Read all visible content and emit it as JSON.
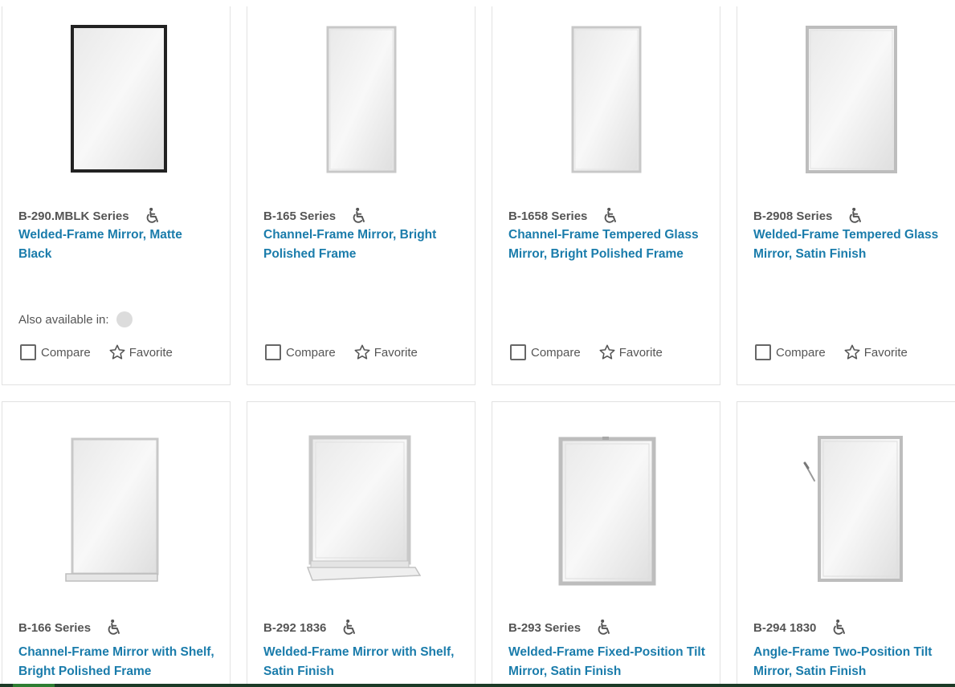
{
  "products": [
    {
      "series": "B-290.MBLK Series",
      "title": "Welded-Frame Mirror, Matte Black",
      "frame_color": "#222222",
      "also_available_label": "Also available in:",
      "compare_label": "Compare",
      "favorite_label": "Favorite"
    },
    {
      "series": "B-165 Series",
      "title": "Channel-Frame Mirror, Bright Polished Frame",
      "frame_color": "#c8c8c8",
      "compare_label": "Compare",
      "favorite_label": "Favorite"
    },
    {
      "series": "B-1658 Series",
      "title": "Channel-Frame Tempered Glass Mirror, Bright Polished Frame",
      "frame_color": "#c8c8c8",
      "compare_label": "Compare",
      "favorite_label": "Favorite"
    },
    {
      "series": "B-2908 Series",
      "title": "Welded-Frame Tempered Glass Mirror, Satin Finish",
      "frame_color": "#bdbdbd",
      "compare_label": "Compare",
      "favorite_label": "Favorite"
    },
    {
      "series": "B-166 Series",
      "title": "Channel-Frame Mirror with Shelf, Bright Polished Frame",
      "frame_color": "#c8c8c8"
    },
    {
      "series": "B-292 1836",
      "title": "Welded-Frame Mirror with Shelf, Satin Finish",
      "frame_color": "#c8c8c8"
    },
    {
      "series": "B-293 Series",
      "title": "Welded-Frame Fixed-Position Tilt Mirror, Satin Finish",
      "frame_color": "#bdbdbd"
    },
    {
      "series": "B-294 1830",
      "title": "Angle-Frame Two-Position Tilt Mirror, Satin Finish",
      "frame_color": "#bdbdbd"
    }
  ],
  "icons": {
    "accessibility": "wheelchair-icon",
    "compare": "checkbox-icon",
    "favorite": "star-outline-icon"
  },
  "colors": {
    "link": "#1a7cab",
    "text": "#555555",
    "border": "#e2e2e2",
    "swatch": "#dcdcdc"
  }
}
